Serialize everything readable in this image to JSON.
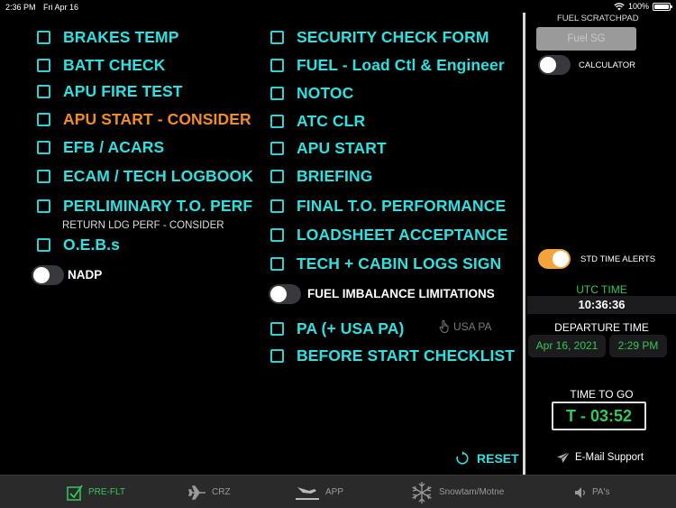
{
  "status_bar": {
    "time": "2:36 PM",
    "date": "Fri Apr 16",
    "battery": "100%"
  },
  "left_checklist": [
    {
      "label": "BRAKES TEMP",
      "highlight": false
    },
    {
      "label": "BATT CHECK",
      "highlight": false
    },
    {
      "label": "APU FIRE TEST",
      "highlight": false
    },
    {
      "label": "APU START - CONSIDER",
      "highlight": true
    },
    {
      "label": "EFB / ACARS",
      "highlight": false
    },
    {
      "label": "ECAM / TECH LOGBOOK",
      "highlight": false
    },
    {
      "label": "PERLIMINARY T.O. PERF",
      "highlight": false
    },
    {
      "label": "O.E.B.s",
      "highlight": false
    }
  ],
  "return_note": "RETURN LDG PERF - CONSIDER",
  "nadp": {
    "label": "NADP",
    "on": false
  },
  "right_checklist": [
    {
      "label": "SECURITY CHECK FORM"
    },
    {
      "label": "FUEL - Load Ctl & Engineer"
    },
    {
      "label": "NOTOC"
    },
    {
      "label": "ATC CLR"
    },
    {
      "label": "APU START"
    },
    {
      "label": "BRIEFING"
    },
    {
      "label": "FINAL T.O. PERFORMANCE"
    },
    {
      "label": "LOADSHEET ACCEPTANCE"
    },
    {
      "label": "TECH + CABIN LOGS SIGN"
    },
    {
      "label": "PA (+ USA PA)"
    },
    {
      "label": "BEFORE START CHECKLIST"
    }
  ],
  "fuel_imbalance": {
    "label": "FUEL IMBALANCE  LIMITATIONS",
    "on": false
  },
  "usa_pa": {
    "label": "USA PA",
    "icon": "hand-pointer-icon"
  },
  "sidebar": {
    "fuel_scratchpad_title": "FUEL SCRATCHPAD",
    "fuel_button": "Fuel SG",
    "calculator_label": "CALCULATOR",
    "std_time_alerts_label": "STD TIME ALERTS",
    "utc_label": "UTC TIME",
    "utc_value": "10:36:36",
    "departure_label": "DEPARTURE TIME",
    "departure_date": "Apr 16, 2021",
    "departure_time": "2:29 PM",
    "time_to_go_label": "TIME TO GO",
    "time_to_go_value": "T - 03:52"
  },
  "reset_label": "RESET",
  "email_label": "E-Mail Support",
  "tabs": [
    {
      "label": "PRE-FLT",
      "icon": "checkbox-icon",
      "active": true
    },
    {
      "label": "CRZ",
      "icon": "airplane-icon",
      "active": false
    },
    {
      "label": "APP",
      "icon": "landing-icon",
      "active": false
    },
    {
      "label": "Snowtam/Motne",
      "icon": "snowflake-icon",
      "active": false
    },
    {
      "label": "PA's",
      "icon": "speaker-icon",
      "active": false
    }
  ],
  "colors": {
    "cyan": "#2fe0e0",
    "orange": "#f28c28",
    "green": "#34c759",
    "toggle_on": "#f2a33a"
  }
}
